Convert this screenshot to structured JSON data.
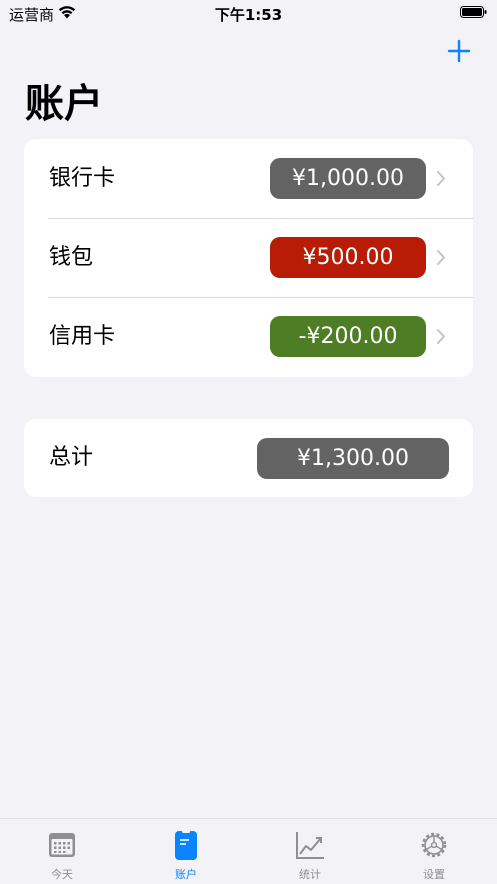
{
  "status_bar": {
    "carrier": "运营商",
    "time": "下午1:53"
  },
  "header": {
    "title": "账户",
    "add_icon": "plus-icon"
  },
  "accounts": [
    {
      "name": "银行卡",
      "amount": "¥1,000.00",
      "color": "#636363"
    },
    {
      "name": "钱包",
      "amount": "¥500.00",
      "color": "#b81c06"
    },
    {
      "name": "信用卡",
      "amount": "-¥200.00",
      "color": "#4e7d25"
    }
  ],
  "total": {
    "label": "总计",
    "amount": "¥1,300.00",
    "color": "#636363"
  },
  "tabs": [
    {
      "label": "今天",
      "icon": "calendar-icon",
      "active": false
    },
    {
      "label": "账户",
      "icon": "account-card-icon",
      "active": true
    },
    {
      "label": "统计",
      "icon": "chart-icon",
      "active": false
    },
    {
      "label": "设置",
      "icon": "gear-icon",
      "active": false
    }
  ],
  "colors": {
    "accent": "#0a84ff",
    "background": "#f2f2f7",
    "inactive_tab": "#8e8e93"
  }
}
